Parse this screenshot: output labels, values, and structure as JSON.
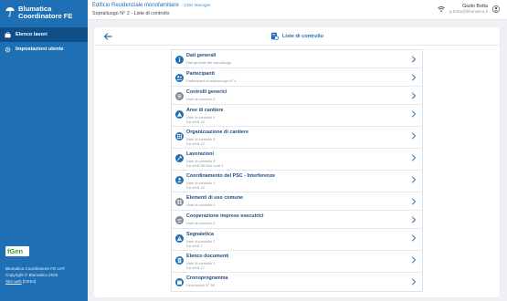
{
  "app": {
    "title_line1": "Blumatica",
    "title_line2": "Coordinatore FE"
  },
  "sidebar": {
    "items": [
      {
        "label": "Elenco lavori",
        "icon": "briefcase-icon",
        "active": true
      },
      {
        "label": "Impostazioni utente",
        "icon": "gear-icon",
        "active": false
      }
    ],
    "fgen_logo": "fGen",
    "footer": {
      "line1": "Blumatica Coordinatore FE UAT",
      "line2": "Copyright © Blumatica 2025",
      "link": "Sito web",
      "code": "[OE54]"
    }
  },
  "header": {
    "project": "Edificio Residenziale monofamiliare",
    "tag": "- CDE Manager",
    "subtitle": "Sopralluogo N° 2 - Liste di controllo",
    "user_name": "Giulio Botta",
    "user_email": "g.botta@blumatica.it",
    "wifi_icon": "wifi-icon",
    "user_icon": "user-icon"
  },
  "toolbar": {
    "title": "Liste di controllo",
    "back_icon": "arrow-left-icon",
    "title_icon": "checklist-icon"
  },
  "rows": [
    {
      "name": "row-dati-generali",
      "title": "Dati generali",
      "line1": "Dati generali del sopralluogo",
      "line2": "",
      "icon": "info-icon",
      "gray": false
    },
    {
      "name": "row-partecipanti",
      "title": "Partecipanti",
      "line1": "Partecipanti al sopralluogo N° 4",
      "line2": "",
      "icon": "people-icon",
      "gray": false
    },
    {
      "name": "row-controlli-generici",
      "title": "Controlli generici",
      "line1": "Liste di controllo 0",
      "line2": "",
      "icon": "list-icon",
      "gray": true
    },
    {
      "name": "row-aree-di-cantiere",
      "title": "Aree di cantiere",
      "line1": "Liste di controllo 4",
      "line2": "Da verifi 15",
      "icon": "area-icon",
      "gray": false
    },
    {
      "name": "row-organizzazione-di-cantiere",
      "title": "Organizzazione di cantiere",
      "line1": "Liste di controllo 5",
      "line2": "Da verifi 12",
      "icon": "organization-icon",
      "gray": false
    },
    {
      "name": "row-lavorazioni",
      "title": "Lavorazioni",
      "line1": "Liste di controllo 4",
      "line2": "Da verifi 98 Non confi 2",
      "icon": "work-icon",
      "gray": false
    },
    {
      "name": "row-coordinamento-psc",
      "title": "Coordinamento del PSC - Interferenze",
      "line1": "Liste di controllo 1",
      "line2": "Da verifi 15",
      "icon": "coordination-icon",
      "gray": false
    },
    {
      "name": "row-elementi-uso-comune",
      "title": "Elementi di uso comune",
      "line1": "Liste di controllo 0",
      "line2": "",
      "icon": "shared-elements-icon",
      "gray": true
    },
    {
      "name": "row-cooperazione-imprese",
      "title": "Cooperazione imprese esecutrici",
      "line1": "Liste di controllo 0",
      "line2": "",
      "icon": "cooperation-icon",
      "gray": true
    },
    {
      "name": "row-segnaletica",
      "title": "Segnaletica",
      "line1": "Liste di controllo 2",
      "line2": "Da verifi 7",
      "icon": "sign-icon",
      "gray": false
    },
    {
      "name": "row-elenco-documenti",
      "title": "Elenco documenti",
      "line1": "Liste di controllo 1",
      "line2": "Da verifi 17",
      "icon": "document-icon",
      "gray": false
    },
    {
      "name": "row-cronoprogramma",
      "title": "Cronoprogramma",
      "line1": "Lavorazioni N° 36",
      "line2": "",
      "icon": "calendar-icon",
      "gray": false
    }
  ],
  "colors": {
    "sidebar": "#1f6fb5",
    "sidebar_active": "#0f4e89",
    "accent": "#1f6fb5",
    "row_title": "#1f4d86"
  }
}
